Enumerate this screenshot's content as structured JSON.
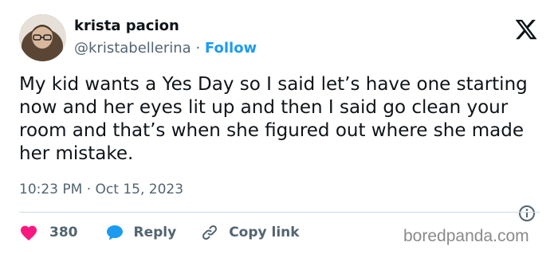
{
  "author": {
    "name": "krista pacion",
    "handle": "@kristabellerina",
    "separator": "·",
    "follow_label": "Follow"
  },
  "tweet": {
    "text": "My kid wants a Yes Day so I said let’s have one starting now and her eyes lit up and then I said go clean your room and that’s when she figured out where she made her mistake.",
    "time": "10:23 PM",
    "separator": "·",
    "date": "Oct 15, 2023"
  },
  "actions": {
    "like_count": "380",
    "reply_label": "Reply",
    "copy_link_label": "Copy link"
  },
  "icons": {
    "logo": "x-logo-icon",
    "like": "heart-icon",
    "reply": "speech-bubble-icon",
    "copy": "link-icon",
    "info": "info-icon"
  },
  "colors": {
    "text": "#0f1419",
    "muted": "#536471",
    "follow": "#1d9bf0",
    "like": "#f91880",
    "reply": "#1d9bf0",
    "divider": "#cfd9de"
  },
  "watermark": "boredpanda.com"
}
